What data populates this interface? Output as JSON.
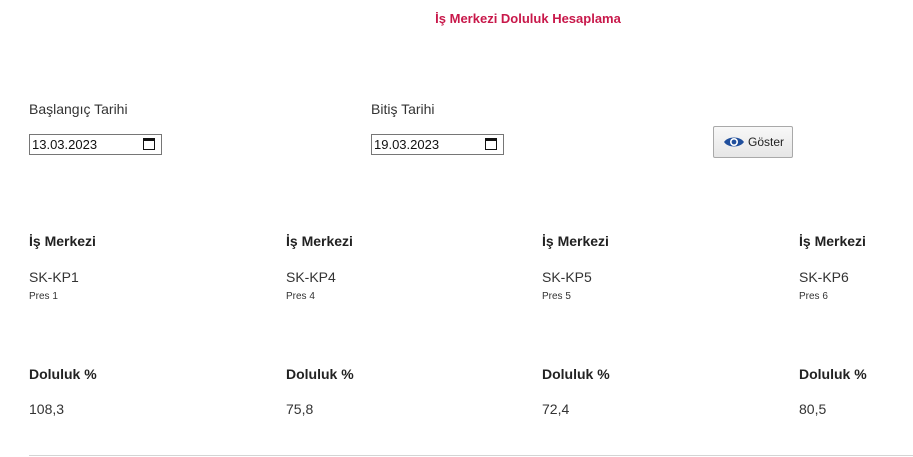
{
  "page": {
    "title": "İş Merkezi Doluluk Hesaplama"
  },
  "filters": {
    "start_label": "Başlangıç Tarihi",
    "start_value": "13.03.2023",
    "end_label": "Bitiş Tarihi",
    "end_value": "19.03.2023",
    "show_button_label": "Göster",
    "show_button_icon": "eye-icon"
  },
  "colors": {
    "title": "#c8184a",
    "eye_icon": "#1f4e9c"
  },
  "work_centers": [
    {
      "heading": "İş Merkezi",
      "code": "SK-KP1",
      "name": "Pres 1",
      "occupancy_heading": "Doluluk %",
      "occupancy": "108,3"
    },
    {
      "heading": "İş Merkezi",
      "code": "SK-KP4",
      "name": "Pres 4",
      "occupancy_heading": "Doluluk %",
      "occupancy": "75,8"
    },
    {
      "heading": "İş Merkezi",
      "code": "SK-KP5",
      "name": "Pres 5",
      "occupancy_heading": "Doluluk %",
      "occupancy": "72,4"
    },
    {
      "heading": "İş Merkezi",
      "code": "SK-KP6",
      "name": "Pres 6",
      "occupancy_heading": "Doluluk %",
      "occupancy": "80,5"
    }
  ]
}
